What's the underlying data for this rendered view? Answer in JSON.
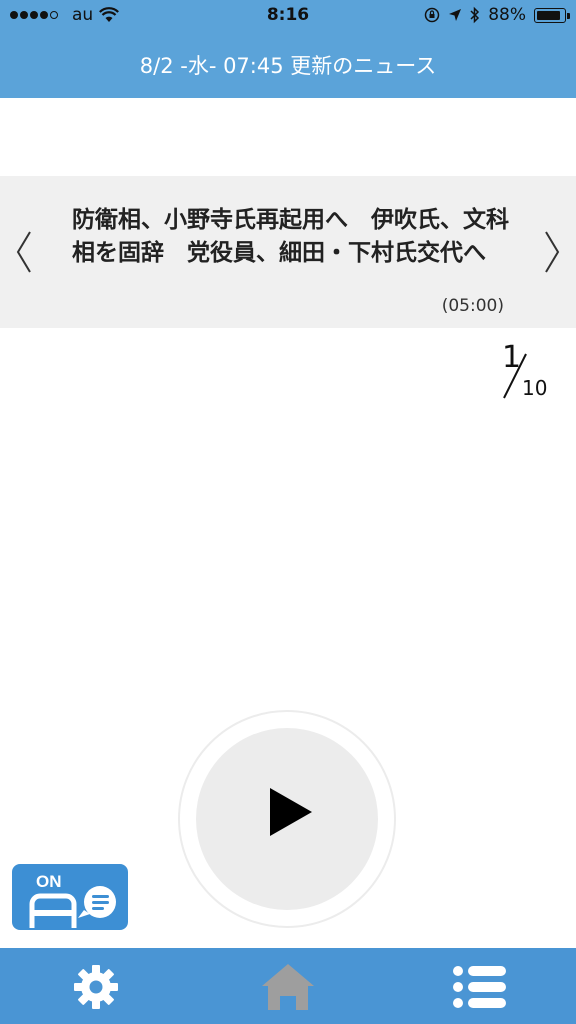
{
  "status_bar": {
    "carrier": "au",
    "time": "8:16",
    "battery": "88%",
    "battery_level": 0.88,
    "signal_dots_filled": 4,
    "signal_dots_total": 5
  },
  "header": {
    "title": "8/2 -水- 07:45 更新のニュース"
  },
  "news": {
    "headline": "防衛相、小野寺氏再起用へ　伊吹氏、文科相を固辞　党役員、細田・下村氏交代へ",
    "time": "(05:00)"
  },
  "counter": {
    "current": "1",
    "total": "10"
  },
  "toggle": {
    "label": "ON"
  },
  "colors": {
    "header_blue": "#5ba3d9",
    "nav_blue": "#4a95d4",
    "toggle_blue": "#3d8fd4",
    "panel_gray": "#f0f0f0",
    "home_icon_gray": "#9e9e9e"
  },
  "icons": {
    "prev": "chevron-left-icon",
    "next": "chevron-right-icon",
    "play": "play-icon",
    "settings": "gear-icon",
    "home": "home-icon",
    "list": "list-icon"
  }
}
